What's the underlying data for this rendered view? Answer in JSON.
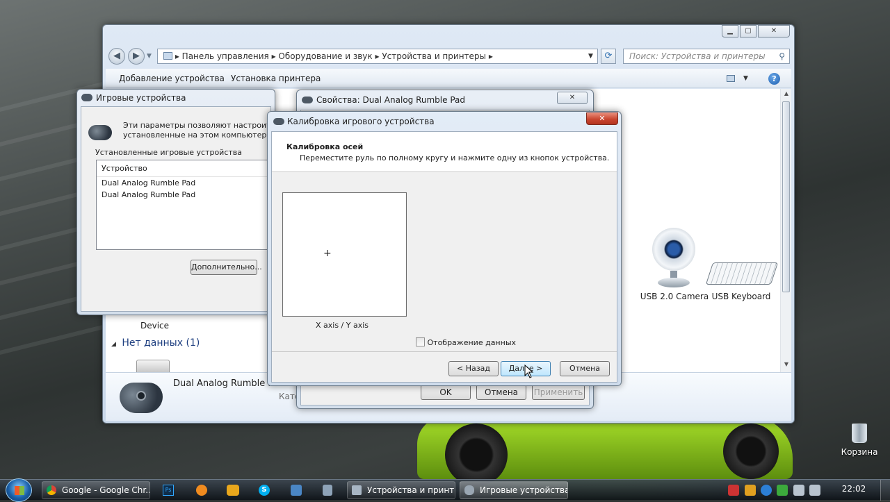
{
  "explorer": {
    "breadcrumb": [
      "Панель управления",
      "Оборудование и звук",
      "Устройства и принтеры"
    ],
    "search_placeholder": "Поиск: Устройства и принтеры",
    "toolbar": {
      "add_device": "Добавление устройства",
      "install_printer": "Установка принтера"
    },
    "devices": {
      "camera": "USB 2.0 Camera",
      "keyboard": "USB Keyboard",
      "partial": "Device"
    },
    "group": {
      "label": "Нет данных (1)"
    },
    "details": {
      "name": "Dual Analog Rumble Pa",
      "category": "Кате"
    }
  },
  "game_controllers": {
    "title": "Игровые устройства",
    "description_1": "Эти параметры позволяют настроить иг",
    "description_2": "установленные на этом компьютере.",
    "installed_label": "Установленные игровые устройства",
    "column_header": "Устройство",
    "items": [
      "Dual Analog Rumble Pad",
      "Dual Analog Rumble Pad"
    ],
    "advanced_button": "Дополнительно..."
  },
  "properties": {
    "title": "Свойства: Dual Analog Rumble Pad",
    "ok": "OK",
    "cancel": "Отмена",
    "apply": "Применить"
  },
  "calibration": {
    "title": "Калибровка игрового устройства",
    "heading": "Калибровка осей",
    "instruction": "Переместите руль по полному кругу и нажмите одну из кнопок устройства.",
    "axis_label": "X axis / Y axis",
    "show_data_label": "Отображение данных",
    "show_data_checked": false,
    "back": "< Назад",
    "next": "Далее >",
    "cancel": "Отмена"
  },
  "desktop": {
    "recycle_bin": "Корзина"
  },
  "taskbar": {
    "items": [
      {
        "label": "Google - Google Chr..."
      },
      {
        "label": "Устройства и принт..."
      },
      {
        "label": "Игровые устройства"
      }
    ],
    "clock": "22:02"
  },
  "colors": {
    "accent": "#3c7fb1",
    "close_red": "#c9452f",
    "lime_car": "#8fce1c"
  }
}
